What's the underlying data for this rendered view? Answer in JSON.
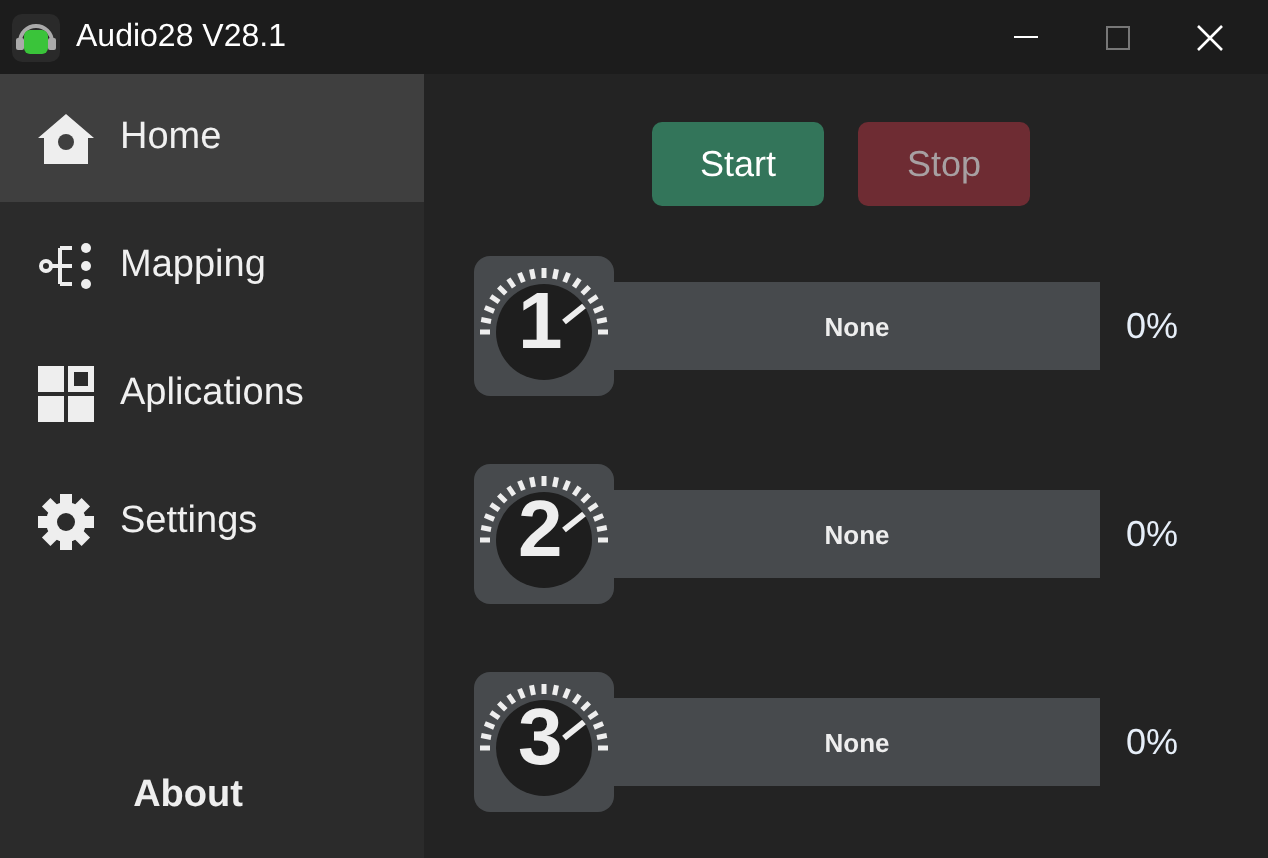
{
  "window": {
    "title": "Audio28 V28.1"
  },
  "sidebar": {
    "items": [
      {
        "label": "Home",
        "kind": "home",
        "selected": true
      },
      {
        "label": "Mapping",
        "kind": "mapping",
        "selected": false
      },
      {
        "label": "Aplications",
        "kind": "apps",
        "selected": false
      },
      {
        "label": "Settings",
        "kind": "settings",
        "selected": false
      }
    ],
    "footer": "About"
  },
  "buttons": [
    {
      "label": "Start",
      "kind": "start",
      "disabled": false
    },
    {
      "label": "Stop",
      "kind": "stop",
      "disabled": true
    }
  ],
  "channels": [
    {
      "number": "1",
      "device": "None",
      "reading": "0%"
    },
    {
      "number": "2",
      "device": "None",
      "reading": "0%"
    },
    {
      "number": "3",
      "device": "None",
      "reading": "0%"
    }
  ]
}
